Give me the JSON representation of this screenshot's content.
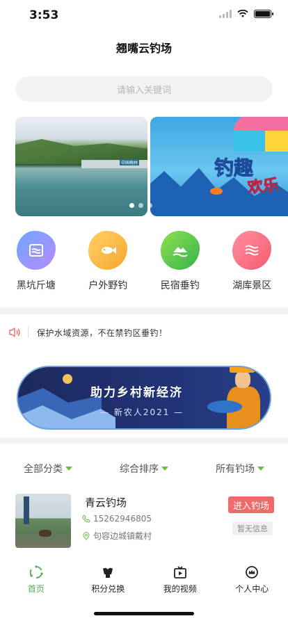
{
  "status_bar": {
    "time": "3:53"
  },
  "header": {
    "title": "翘嘴云钓场"
  },
  "search": {
    "placeholder": "请输入关键词"
  },
  "banner": {
    "slide1_sign": "中国梅林",
    "slide2_title_a": "钓趣",
    "slide2_title_b": "欢乐",
    "slide_count": 3,
    "active_index": 0
  },
  "categories": [
    {
      "label": "黑坑斤塘",
      "icon": "pond-icon",
      "color_from": "#6ea6ff",
      "color_to": "#b88bff"
    },
    {
      "label": "户外野钓",
      "icon": "fish-icon",
      "color_from": "#ffd06a",
      "color_to": "#f7a52b"
    },
    {
      "label": "民宿垂钓",
      "icon": "mountain-lake-icon",
      "color_from": "#8fe04f",
      "color_to": "#36b24a"
    },
    {
      "label": "湖库景区",
      "icon": "waves-icon",
      "color_from": "#ff8fa0",
      "color_to": "#f35b6f"
    }
  ],
  "notice": {
    "icon": "speaker-icon",
    "text": "保护水域资源，不在禁钓区垂钓！"
  },
  "promo": {
    "title": "助力乡村新经济",
    "subtitle": "— 新农人2021 —"
  },
  "filters": [
    {
      "label": "全部分类"
    },
    {
      "label": "综合排序"
    },
    {
      "label": "所有钓场"
    }
  ],
  "listing": {
    "name": "青云钓场",
    "phone": "15262946805",
    "address": "句容边城镇戴村",
    "enter_label": "进入钓场",
    "info_label": "暂无信息"
  },
  "tabbar": [
    {
      "label": "首页",
      "icon": "home-icon",
      "active": true
    },
    {
      "label": "积分兑换",
      "icon": "points-exchange-icon",
      "active": false
    },
    {
      "label": "我的视频",
      "icon": "video-icon",
      "active": false
    },
    {
      "label": "个人中心",
      "icon": "profile-icon",
      "active": false
    }
  ],
  "colors": {
    "accent": "#4caf50",
    "enter_button": "#ef6a6a",
    "caret": "#6bbf3a"
  }
}
